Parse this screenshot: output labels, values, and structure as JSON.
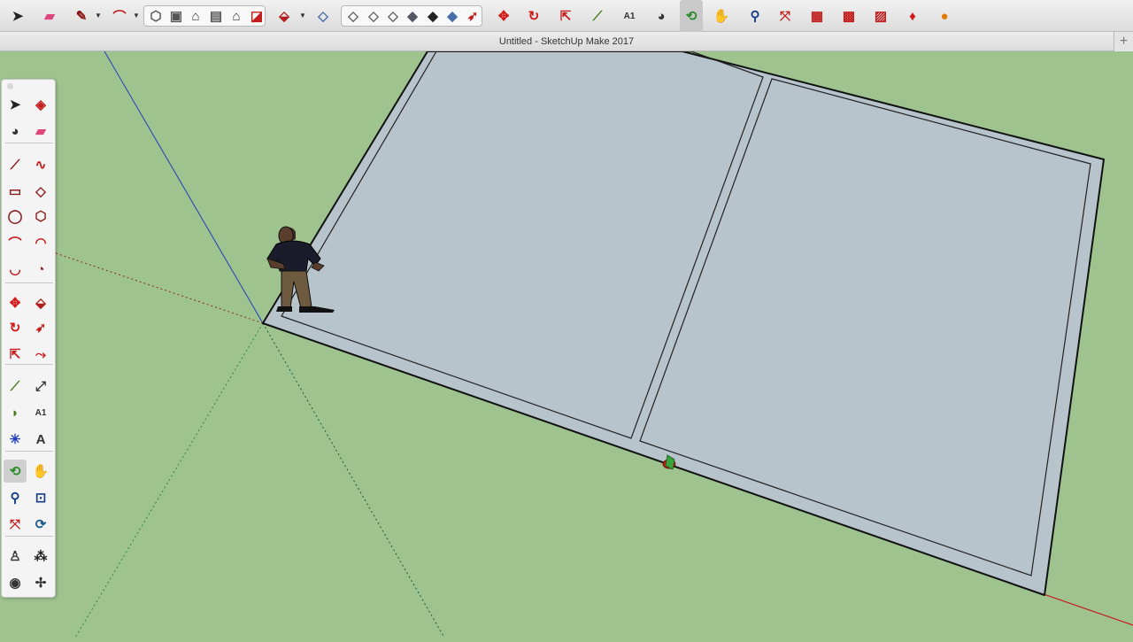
{
  "window": {
    "title": "Untitled - SketchUp Make 2017"
  },
  "tabs": {
    "add_label": "+"
  },
  "colors": {
    "ground": "#9ec38e",
    "face": "#b7c4cc",
    "axis_red": "#c41c1c",
    "axis_green": "#2f8a2f",
    "axis_blue": "#1f3fbf",
    "toolbar_bg": "#e6e6e6"
  },
  "toolbar": {
    "items": [
      {
        "id": "select",
        "icon": "select-arrow-icon",
        "glyph": "➤",
        "color": "#222"
      },
      {
        "id": "eraser",
        "icon": "eraser-icon",
        "glyph": "▰",
        "color": "#e0457b"
      },
      {
        "id": "line",
        "icon": "pencil-line-icon",
        "glyph": "✎",
        "color": "#8a1010"
      },
      {
        "id": "arc",
        "icon": "arc-icon",
        "glyph": "⌒",
        "color": "#c41c1c"
      },
      {
        "id": "view-iso",
        "icon": "iso-view-icon",
        "glyph": "⬡",
        "color": "#555"
      },
      {
        "id": "view-top",
        "icon": "top-view-icon",
        "glyph": "▣",
        "color": "#555"
      },
      {
        "id": "view-front",
        "icon": "front-view-icon",
        "glyph": "⌂",
        "color": "#333"
      },
      {
        "id": "view-right",
        "icon": "right-view-icon",
        "glyph": "▤",
        "color": "#555"
      },
      {
        "id": "view-back",
        "icon": "back-view-icon",
        "glyph": "⌂",
        "color": "#333"
      },
      {
        "id": "section",
        "icon": "section-plane-icon",
        "glyph": "◪",
        "color": "#c41c1c"
      },
      {
        "id": "push-pull",
        "icon": "push-pull-icon",
        "glyph": "⬙",
        "color": "#b02020"
      },
      {
        "id": "style-xray",
        "icon": "xray-style-icon",
        "glyph": "◇",
        "color": "#4a6ea8"
      },
      {
        "id": "style-wire",
        "icon": "wireframe-style-icon",
        "glyph": "◇",
        "color": "#666"
      },
      {
        "id": "style-hidden",
        "icon": "hidden-line-style-icon",
        "glyph": "◇",
        "color": "#666"
      },
      {
        "id": "style-shaded",
        "icon": "shaded-style-icon",
        "glyph": "◇",
        "color": "#666"
      },
      {
        "id": "style-textured",
        "icon": "textured-style-icon",
        "glyph": "◆",
        "color": "#556"
      },
      {
        "id": "style-mono",
        "icon": "monochrome-style-icon",
        "glyph": "◆",
        "color": "#222"
      },
      {
        "id": "style-color",
        "icon": "color-style-icon",
        "glyph": "◆",
        "color": "#4a6ea8"
      },
      {
        "id": "follow-me",
        "icon": "follow-me-icon",
        "glyph": "➶",
        "color": "#c41c1c"
      },
      {
        "id": "move",
        "icon": "move-icon",
        "glyph": "✥",
        "color": "#d21a1a"
      },
      {
        "id": "rotate",
        "icon": "rotate-icon",
        "glyph": "↻",
        "color": "#d21a1a"
      },
      {
        "id": "scale",
        "icon": "scale-icon",
        "glyph": "⇱",
        "color": "#c41c1c"
      },
      {
        "id": "tape",
        "icon": "tape-measure-icon",
        "glyph": "⟋",
        "color": "#4a7a20"
      },
      {
        "id": "text",
        "icon": "text-label-icon",
        "glyph": "A1",
        "color": "#333"
      },
      {
        "id": "paint",
        "icon": "paint-bucket-icon",
        "glyph": "◕",
        "color": "#333"
      },
      {
        "id": "orbit",
        "icon": "orbit-icon",
        "glyph": "⟲",
        "color": "#2d8a2d"
      },
      {
        "id": "pan",
        "icon": "pan-hand-icon",
        "glyph": "✋",
        "color": "#b08a3a"
      },
      {
        "id": "zoom",
        "icon": "zoom-icon",
        "glyph": "⚲",
        "color": "#1a3d8a"
      },
      {
        "id": "zoom-extents",
        "icon": "zoom-extents-icon",
        "glyph": "⤧",
        "color": "#c41c1c"
      },
      {
        "id": "warehouse",
        "icon": "3d-warehouse-icon",
        "glyph": "▦",
        "color": "#c41c1c"
      },
      {
        "id": "components",
        "icon": "share-model-icon",
        "glyph": "▩",
        "color": "#c41c1c"
      },
      {
        "id": "extension",
        "icon": "extension-warehouse-icon",
        "glyph": "▨",
        "color": "#c41c1c"
      },
      {
        "id": "ruby",
        "icon": "ruby-console-icon",
        "glyph": "♦",
        "color": "#d21a1a"
      },
      {
        "id": "colors",
        "icon": "colors-wheel-icon",
        "glyph": "●",
        "color": "#e07b00"
      }
    ]
  },
  "palette": {
    "items": [
      {
        "icon": "select-arrow-icon",
        "glyph": "➤",
        "color": "#222"
      },
      {
        "icon": "make-component-icon",
        "glyph": "◈",
        "color": "#c41c1c"
      },
      {
        "icon": "paint-bucket-icon",
        "glyph": "◕",
        "color": "#333"
      },
      {
        "icon": "eraser-icon",
        "glyph": "▰",
        "color": "#e0457b"
      },
      {
        "icon": "line-icon",
        "glyph": "⟋",
        "color": "#8a1010"
      },
      {
        "icon": "freehand-icon",
        "glyph": "∿",
        "color": "#c41c1c"
      },
      {
        "icon": "rectangle-icon",
        "glyph": "▭",
        "color": "#8a2020"
      },
      {
        "icon": "rotated-rectangle-icon",
        "glyph": "◇",
        "color": "#8a2020"
      },
      {
        "icon": "circle-icon",
        "glyph": "◯",
        "color": "#8a2020"
      },
      {
        "icon": "polygon-icon",
        "glyph": "⬡",
        "color": "#8a2020"
      },
      {
        "icon": "arc-icon",
        "glyph": "⌒",
        "color": "#c41c1c"
      },
      {
        "icon": "two-point-arc-icon",
        "glyph": "◠",
        "color": "#c41c1c"
      },
      {
        "icon": "three-point-arc-icon",
        "glyph": "◡",
        "color": "#c41c1c"
      },
      {
        "icon": "pie-icon",
        "glyph": "◔",
        "color": "#8a2020"
      },
      {
        "icon": "move-icon",
        "glyph": "✥",
        "color": "#d21a1a"
      },
      {
        "icon": "push-pull-icon",
        "glyph": "⬙",
        "color": "#b02020"
      },
      {
        "icon": "rotate-icon",
        "glyph": "↻",
        "color": "#d21a1a"
      },
      {
        "icon": "follow-me-icon",
        "glyph": "➶",
        "color": "#c41c1c"
      },
      {
        "icon": "scale-icon",
        "glyph": "⇱",
        "color": "#c41c1c"
      },
      {
        "icon": "offset-icon",
        "glyph": "⤳",
        "color": "#c41c1c"
      },
      {
        "icon": "tape-measure-icon",
        "glyph": "⟋",
        "color": "#4a7a20"
      },
      {
        "icon": "dimension-icon",
        "glyph": "⤢",
        "color": "#333"
      },
      {
        "icon": "protractor-icon",
        "glyph": "◗",
        "color": "#4a7a20"
      },
      {
        "icon": "text-label-icon",
        "glyph": "A1",
        "color": "#333"
      },
      {
        "icon": "axes-icon",
        "glyph": "✳",
        "color": "#1f3fbf"
      },
      {
        "icon": "3d-text-icon",
        "glyph": "A",
        "color": "#333"
      },
      {
        "icon": "orbit-icon",
        "glyph": "⟲",
        "color": "#2d8a2d"
      },
      {
        "icon": "pan-hand-icon",
        "glyph": "✋",
        "color": "#b08a3a"
      },
      {
        "icon": "zoom-icon",
        "glyph": "⚲",
        "color": "#1a3d8a"
      },
      {
        "icon": "zoom-window-icon",
        "glyph": "⊡",
        "color": "#1a3d8a"
      },
      {
        "icon": "zoom-extents-icon",
        "glyph": "⤧",
        "color": "#c41c1c"
      },
      {
        "icon": "previous-view-icon",
        "glyph": "⟳",
        "color": "#1a5a8a"
      },
      {
        "icon": "position-camera-icon",
        "glyph": "♙",
        "color": "#333"
      },
      {
        "icon": "walk-icon",
        "glyph": "⁂",
        "color": "#222"
      },
      {
        "icon": "look-around-icon",
        "glyph": "◉",
        "color": "#333"
      },
      {
        "icon": "section-plane-icon",
        "glyph": "✢",
        "color": "#333"
      }
    ]
  }
}
